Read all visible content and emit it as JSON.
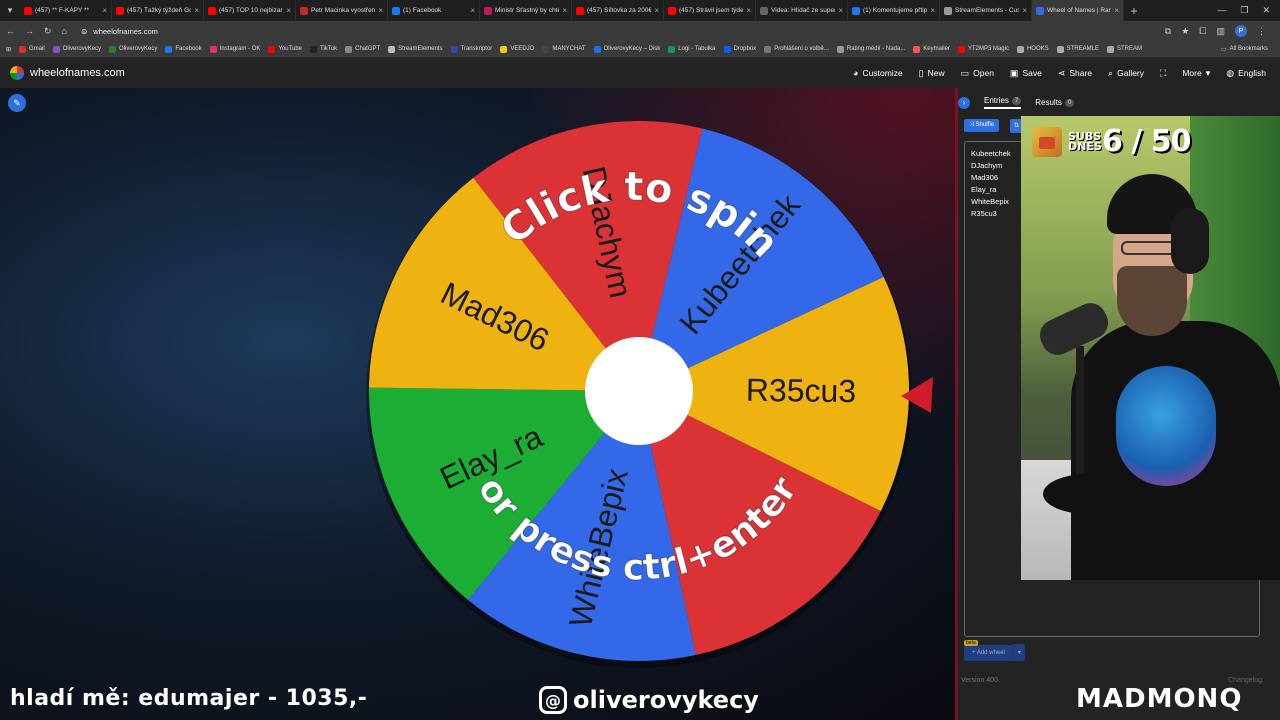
{
  "browser": {
    "tabs": [
      {
        "title": "(457) ** F-KAPY **",
        "color": "#ff0000"
      },
      {
        "title": "(457) Ťažký týždeň Go",
        "color": "#ff0000"
      },
      {
        "title": "(457) TOP 10 nejbizarn",
        "color": "#ff0000"
      },
      {
        "title": "Petr Macinka vyostřen",
        "color": "#c62828"
      },
      {
        "title": "(1) Facebook",
        "color": "#1877f2"
      },
      {
        "title": "Ministr Šťastný by chtě",
        "color": "#c2185b"
      },
      {
        "title": "(457) Šíltovka za 200€",
        "color": "#ff0000"
      },
      {
        "title": "(457) Strávil jsem týde",
        "color": "#ff0000"
      },
      {
        "title": "Videa: Hlídač ze super",
        "color": "#666666"
      },
      {
        "title": "(1) Komentujeme přtip",
        "color": "#1877f2"
      },
      {
        "title": "StreamElements - Cust",
        "color": "#999999"
      },
      {
        "title": "Wheel of Names | Ran",
        "color": "#3369e8"
      }
    ],
    "url": "wheelofnames.com",
    "profile_initial": "P",
    "bookmarks": [
      {
        "label": "Gmail",
        "color": "#d93025"
      },
      {
        "label": "OliverovyKecy",
        "color": "#7e57c2"
      },
      {
        "label": "OliverovyKecy",
        "color": "#2e7d32"
      },
      {
        "label": "Facebook",
        "color": "#1877f2"
      },
      {
        "label": "Instagram - OK",
        "color": "#e1306c"
      },
      {
        "label": "YouTube",
        "color": "#ff0000"
      },
      {
        "label": "TikTok",
        "color": "#222222"
      },
      {
        "label": "ChatGPT",
        "color": "#888888"
      },
      {
        "label": "StreamElements",
        "color": "#bbbbbb"
      },
      {
        "label": "Transkriptor",
        "color": "#3949ab"
      },
      {
        "label": "VEEDJO",
        "color": "#f0c419"
      },
      {
        "label": "MANYCHAT",
        "color": "#444444"
      },
      {
        "label": "OliverovyKecy – Disk",
        "color": "#1a73e8"
      },
      {
        "label": "Logi - Tabulka",
        "color": "#0f9d58"
      },
      {
        "label": "Dropbox",
        "color": "#0061ff"
      },
      {
        "label": "Prohlášení o volbě...",
        "color": "#777777"
      },
      {
        "label": "Rating médií - Nada...",
        "color": "#999999"
      },
      {
        "label": "Keymailer",
        "color": "#ff5252"
      },
      {
        "label": "YT2MP3 Magic",
        "color": "#ff0000"
      },
      {
        "label": "HOOKS",
        "color": "#aaaaaa"
      },
      {
        "label": "STREAMLE",
        "color": "#aaaaaa"
      },
      {
        "label": "STREAM",
        "color": "#aaaaaa"
      }
    ],
    "all_bookmarks": "All Bookmarks"
  },
  "site": {
    "name": "wheelofnames.com",
    "nav": {
      "customize": "Customize",
      "new": "New",
      "open": "Open",
      "save": "Save",
      "share": "Share",
      "gallery": "Gallery",
      "more": "More",
      "language": "English"
    }
  },
  "wheel": {
    "segments": [
      {
        "label": "R35cu3",
        "color": "#eeb211"
      },
      {
        "label": "",
        "color": "#db3236"
      },
      {
        "label": "WhiteBepix",
        "color": "#3369e8"
      },
      {
        "label": "Elay_ra",
        "color": "#1cae34"
      },
      {
        "label": "Mad306",
        "color": "#eeb211"
      },
      {
        "label": "DJachym",
        "color": "#db3236"
      },
      {
        "label": "Kubeetchek",
        "color": "#3369e8"
      }
    ],
    "prompt_top": "Click to spin",
    "prompt_bottom": "or press ctrl+enter"
  },
  "sidebar": {
    "tab_entries": "Entries",
    "entries_count": "7",
    "tab_results": "Results",
    "results_count": "0",
    "shuffle": "Shuffle",
    "entries": [
      "Kubeetchek",
      "DJachym",
      "Mad306",
      "Elay_ra",
      "WhiteBepix",
      "R35cu3"
    ],
    "beta": "beta",
    "add_wheel": "Add wheel",
    "version": "Version 400",
    "changelog": "Changelog"
  },
  "overlay": {
    "subs_label": "SUBS DNES",
    "subs_count": "6 / 50",
    "ticker": "hladí mě: edumajer - 1035,-",
    "threads_handle": "oliverovykecy",
    "brand": "MADMONQ"
  }
}
